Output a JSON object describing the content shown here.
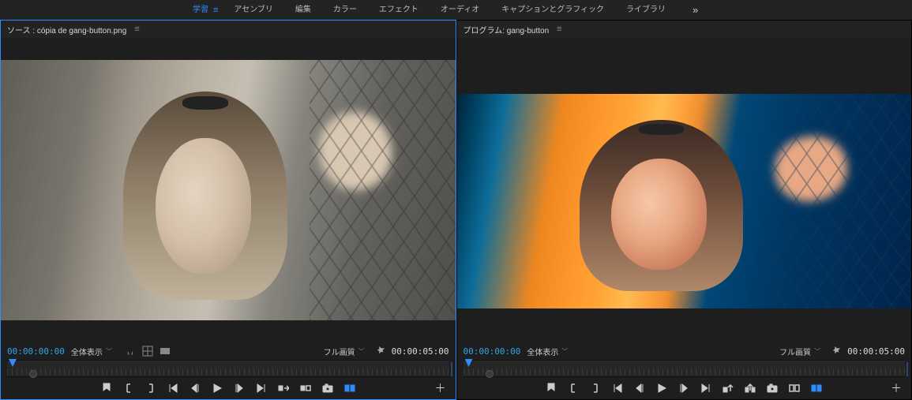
{
  "workspace": {
    "tabs": [
      "学習",
      "アセンブリ",
      "編集",
      "カラー",
      "エフェクト",
      "オーディオ",
      "キャプションとグラフィック",
      "ライブラリ"
    ],
    "active_index": 0,
    "more_icon": "chevrons-right"
  },
  "source_panel": {
    "title_prefix": "ソース : ",
    "clip_name": "cópia de gang-button.png",
    "timecode_in": "00:00:00:00",
    "zoom_label": "全体表示",
    "quality_label": "フル画質",
    "timecode_out": "00:00:05:00"
  },
  "program_panel": {
    "title_prefix": "プログラム: ",
    "sequence_name": "gang-button",
    "timecode_in": "00:00:00:00",
    "zoom_label": "全体表示",
    "quality_label": "フル画質",
    "timecode_out": "00:00:05:00"
  },
  "icons": {
    "marker": "marker-icon",
    "in_bracket": "mark-in-icon",
    "out_bracket": "mark-out-icon",
    "go_in": "go-to-in-icon",
    "step_back": "step-back-icon",
    "play": "play-icon",
    "step_fwd": "step-forward-icon",
    "go_out": "go-to-out-icon",
    "insert": "insert-icon",
    "overwrite": "overwrite-icon",
    "export_frame": "export-frame-icon",
    "comparison": "comparison-view-icon",
    "lift": "lift-icon",
    "extract": "extract-icon"
  }
}
